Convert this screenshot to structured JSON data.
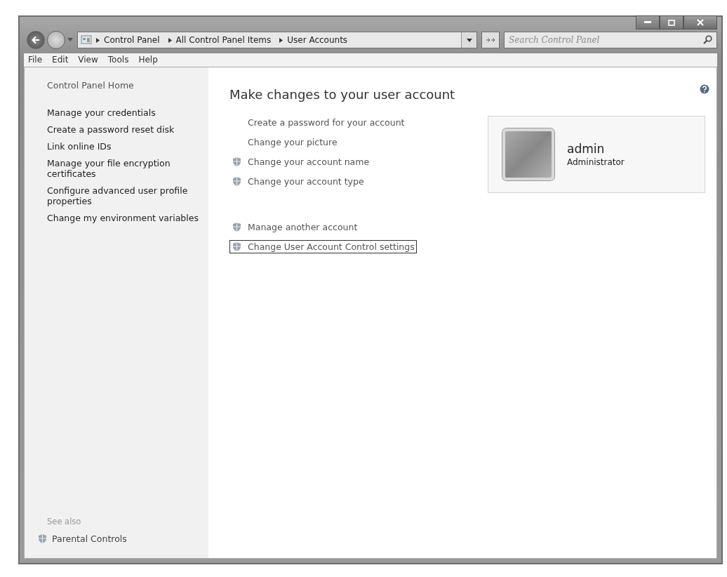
{
  "breadcrumb": [
    "Control Panel",
    "All Control Panel Items",
    "User Accounts"
  ],
  "search": {
    "placeholder": "Search Control Panel"
  },
  "menu": [
    "File",
    "Edit",
    "View",
    "Tools",
    "Help"
  ],
  "sidebar": {
    "home": "Control Panel Home",
    "links": [
      {
        "label": "Manage your credentials",
        "shield": false
      },
      {
        "label": "Create a password reset disk",
        "shield": false
      },
      {
        "label": "Link online IDs",
        "shield": false
      },
      {
        "label": "Manage your file encryption certificates",
        "shield": false
      },
      {
        "label": "Configure advanced user profile properties",
        "shield": false
      },
      {
        "label": "Change my environment variables",
        "shield": false
      }
    ],
    "see_also": {
      "heading": "See also",
      "links": [
        {
          "label": "Parental Controls",
          "shield": true
        }
      ]
    }
  },
  "main": {
    "heading": "Make changes to your user account",
    "tasks": [
      {
        "label": "Create a password for your account",
        "shield": false,
        "focused": false
      },
      {
        "label": "Change your picture",
        "shield": false,
        "focused": false
      },
      {
        "label": "Change your account name",
        "shield": true,
        "focused": false
      },
      {
        "label": "Change your account type",
        "shield": true,
        "focused": false
      }
    ],
    "more_tasks": [
      {
        "label": "Manage another account",
        "shield": true,
        "focused": false
      },
      {
        "label": "Change User Account Control settings",
        "shield": true,
        "focused": true
      }
    ],
    "account": {
      "name": "admin",
      "role": "Administrator"
    }
  }
}
